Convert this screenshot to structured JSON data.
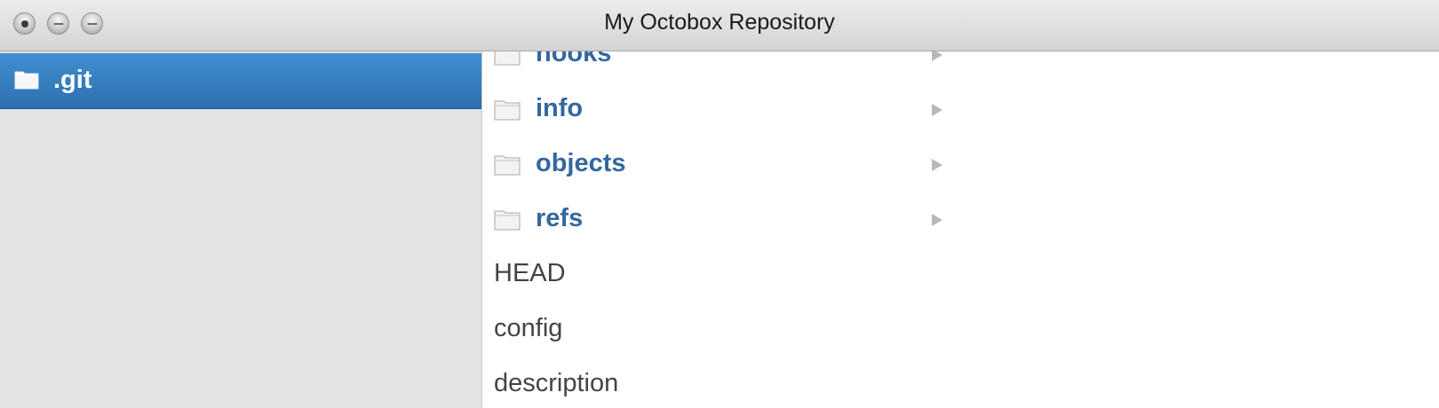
{
  "window": {
    "title": "My Octobox Repository"
  },
  "column1": {
    "items": [
      {
        "name": ".git",
        "type": "folder",
        "selected": true
      }
    ]
  },
  "column2": {
    "items": [
      {
        "name": "hooks",
        "type": "folder"
      },
      {
        "name": "info",
        "type": "folder"
      },
      {
        "name": "objects",
        "type": "folder"
      },
      {
        "name": "refs",
        "type": "folder"
      },
      {
        "name": "HEAD",
        "type": "file"
      },
      {
        "name": "config",
        "type": "file"
      },
      {
        "name": "description",
        "type": "file"
      }
    ]
  },
  "icons": {
    "folder": "folder-icon",
    "disclosure": "chevron-right-icon",
    "close": "close-button",
    "minimize": "minimize-button",
    "zoom": "zoom-button"
  },
  "colors": {
    "selection": "#2f74b5",
    "folder_label": "#35679e",
    "file_label": "#444444",
    "sidebar_bg": "#e4e4e4"
  }
}
